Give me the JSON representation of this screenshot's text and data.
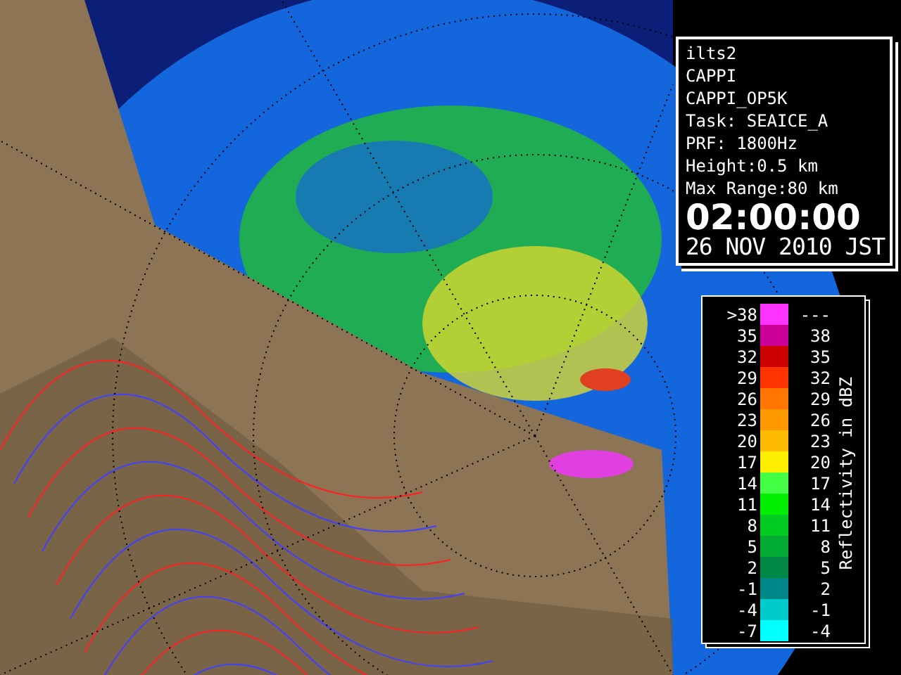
{
  "radar_info": {
    "lines": [
      "ilts2",
      "CAPPI",
      "CAPPI_OP5K",
      "Task: SEAICE_A",
      "PRF: 1800Hz",
      "Height:0.5 km",
      "Max Range:80 km"
    ],
    "time": "02:00:00",
    "date": "26 NOV 2010 JST"
  },
  "legend": {
    "title": "Reflectivity in dBZ",
    "rows": [
      {
        "lower": ">38",
        "upper": "---",
        "color": "#ff33ff"
      },
      {
        "lower": "35",
        "upper": "38",
        "color": "#cc0099"
      },
      {
        "lower": "32",
        "upper": "35",
        "color": "#cc0000"
      },
      {
        "lower": "29",
        "upper": "32",
        "color": "#ff3300"
      },
      {
        "lower": "26",
        "upper": "29",
        "color": "#ff7700"
      },
      {
        "lower": "23",
        "upper": "26",
        "color": "#ff9900"
      },
      {
        "lower": "20",
        "upper": "23",
        "color": "#ffbb00"
      },
      {
        "lower": "17",
        "upper": "20",
        "color": "#ffee00"
      },
      {
        "lower": "14",
        "upper": "17",
        "color": "#44ff44"
      },
      {
        "lower": "11",
        "upper": "14",
        "color": "#00ee00"
      },
      {
        "lower": "8",
        "upper": "11",
        "color": "#00cc22"
      },
      {
        "lower": "5",
        "upper": "8",
        "color": "#00aa33"
      },
      {
        "lower": "2",
        "upper": "5",
        "color": "#008844"
      },
      {
        "lower": "-1",
        "upper": "2",
        "color": "#008888"
      },
      {
        "lower": "-4",
        "upper": "-1",
        "color": "#00cccc"
      },
      {
        "lower": "-7",
        "upper": "-4",
        "color": "#00ffff"
      }
    ]
  }
}
